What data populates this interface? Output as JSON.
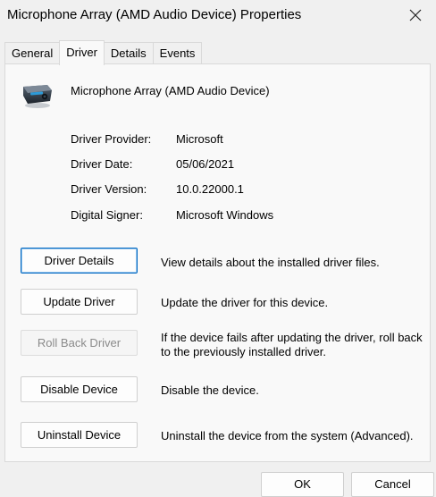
{
  "window": {
    "title": "Microphone Array (AMD Audio Device) Properties",
    "close_icon": "close-icon"
  },
  "tabs": [
    {
      "label": "General",
      "active": false
    },
    {
      "label": "Driver",
      "active": true
    },
    {
      "label": "Details",
      "active": false
    },
    {
      "label": "Events",
      "active": false
    }
  ],
  "device": {
    "name": "Microphone Array (AMD Audio Device)",
    "icon": "microphone-array-icon"
  },
  "info": [
    {
      "label": "Driver Provider:",
      "value": "Microsoft"
    },
    {
      "label": "Driver Date:",
      "value": "05/06/2021"
    },
    {
      "label": "Driver Version:",
      "value": "10.0.22000.1"
    },
    {
      "label": "Digital Signer:",
      "value": "Microsoft Windows"
    }
  ],
  "actions": [
    {
      "label": "Driver Details",
      "description": "View details about the installed driver files.",
      "enabled": true,
      "focused": true
    },
    {
      "label": "Update Driver",
      "description": "Update the driver for this device.",
      "enabled": true,
      "focused": false
    },
    {
      "label": "Roll Back Driver",
      "description": "If the device fails after updating the driver, roll back to the previously installed driver.",
      "enabled": false,
      "focused": false
    },
    {
      "label": "Disable Device",
      "description": "Disable the device.",
      "enabled": true,
      "focused": false
    },
    {
      "label": "Uninstall Device",
      "description": "Uninstall the device from the system (Advanced).",
      "enabled": true,
      "focused": false
    }
  ],
  "footer": {
    "ok_label": "OK",
    "cancel_label": "Cancel"
  },
  "colors": {
    "focus_border": "#0067c0",
    "background": "#f0f0f0",
    "panel": "#f9f9f9"
  }
}
